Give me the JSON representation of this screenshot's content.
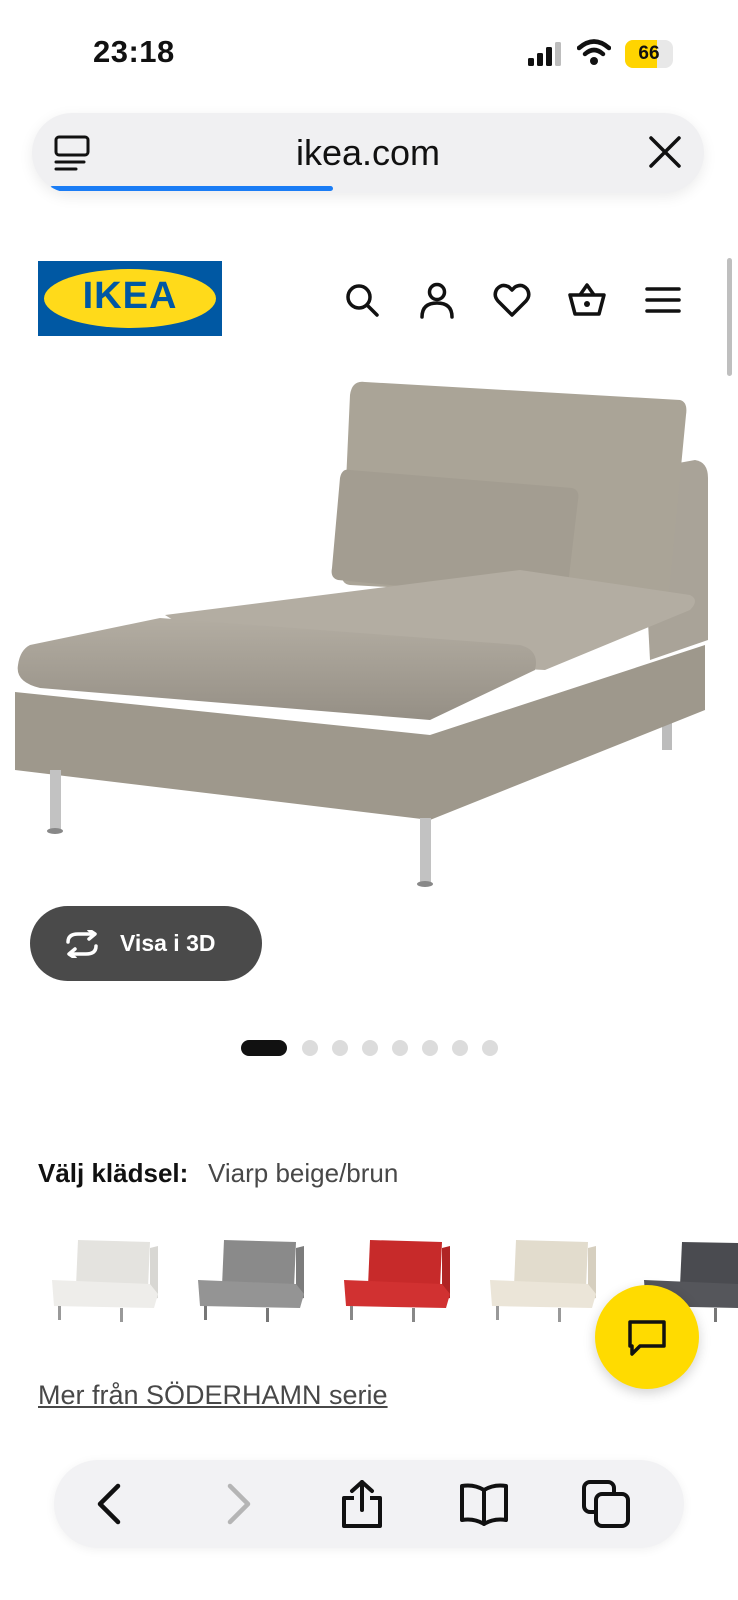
{
  "status_bar": {
    "time": "23:18",
    "battery": "66"
  },
  "browser": {
    "url": "ikea.com"
  },
  "header": {
    "logo_text": "IKEA"
  },
  "product": {
    "view_3d_label": "Visa i 3D",
    "image_count": 8,
    "active_image": 1,
    "fabric_label": "Välj klädsel:",
    "fabric_value": "Viarp beige/brun",
    "swatches": [
      {
        "name": "white",
        "color": "#ecebe8"
      },
      {
        "name": "grey",
        "color": "#8f8f8f"
      },
      {
        "name": "red",
        "color": "#cc2b2b"
      },
      {
        "name": "beige",
        "color": "#e6e0d3"
      },
      {
        "name": "dark-grey",
        "color": "#4e4f54"
      }
    ],
    "series_link": "Mer från SÖDERHAMN serie"
  },
  "colors": {
    "ikea_blue": "#0058a3",
    "ikea_yellow": "#ffda1a",
    "progress_blue": "#1a7cf5",
    "chat_yellow": "#ffdb00"
  },
  "icons": [
    "reader-icon",
    "close-icon",
    "search-icon",
    "account-icon",
    "heart-icon",
    "basket-icon",
    "menu-icon",
    "rotate-icon",
    "chat-icon",
    "back-icon",
    "forward-icon",
    "share-icon",
    "bookmarks-icon",
    "tabs-icon"
  ]
}
